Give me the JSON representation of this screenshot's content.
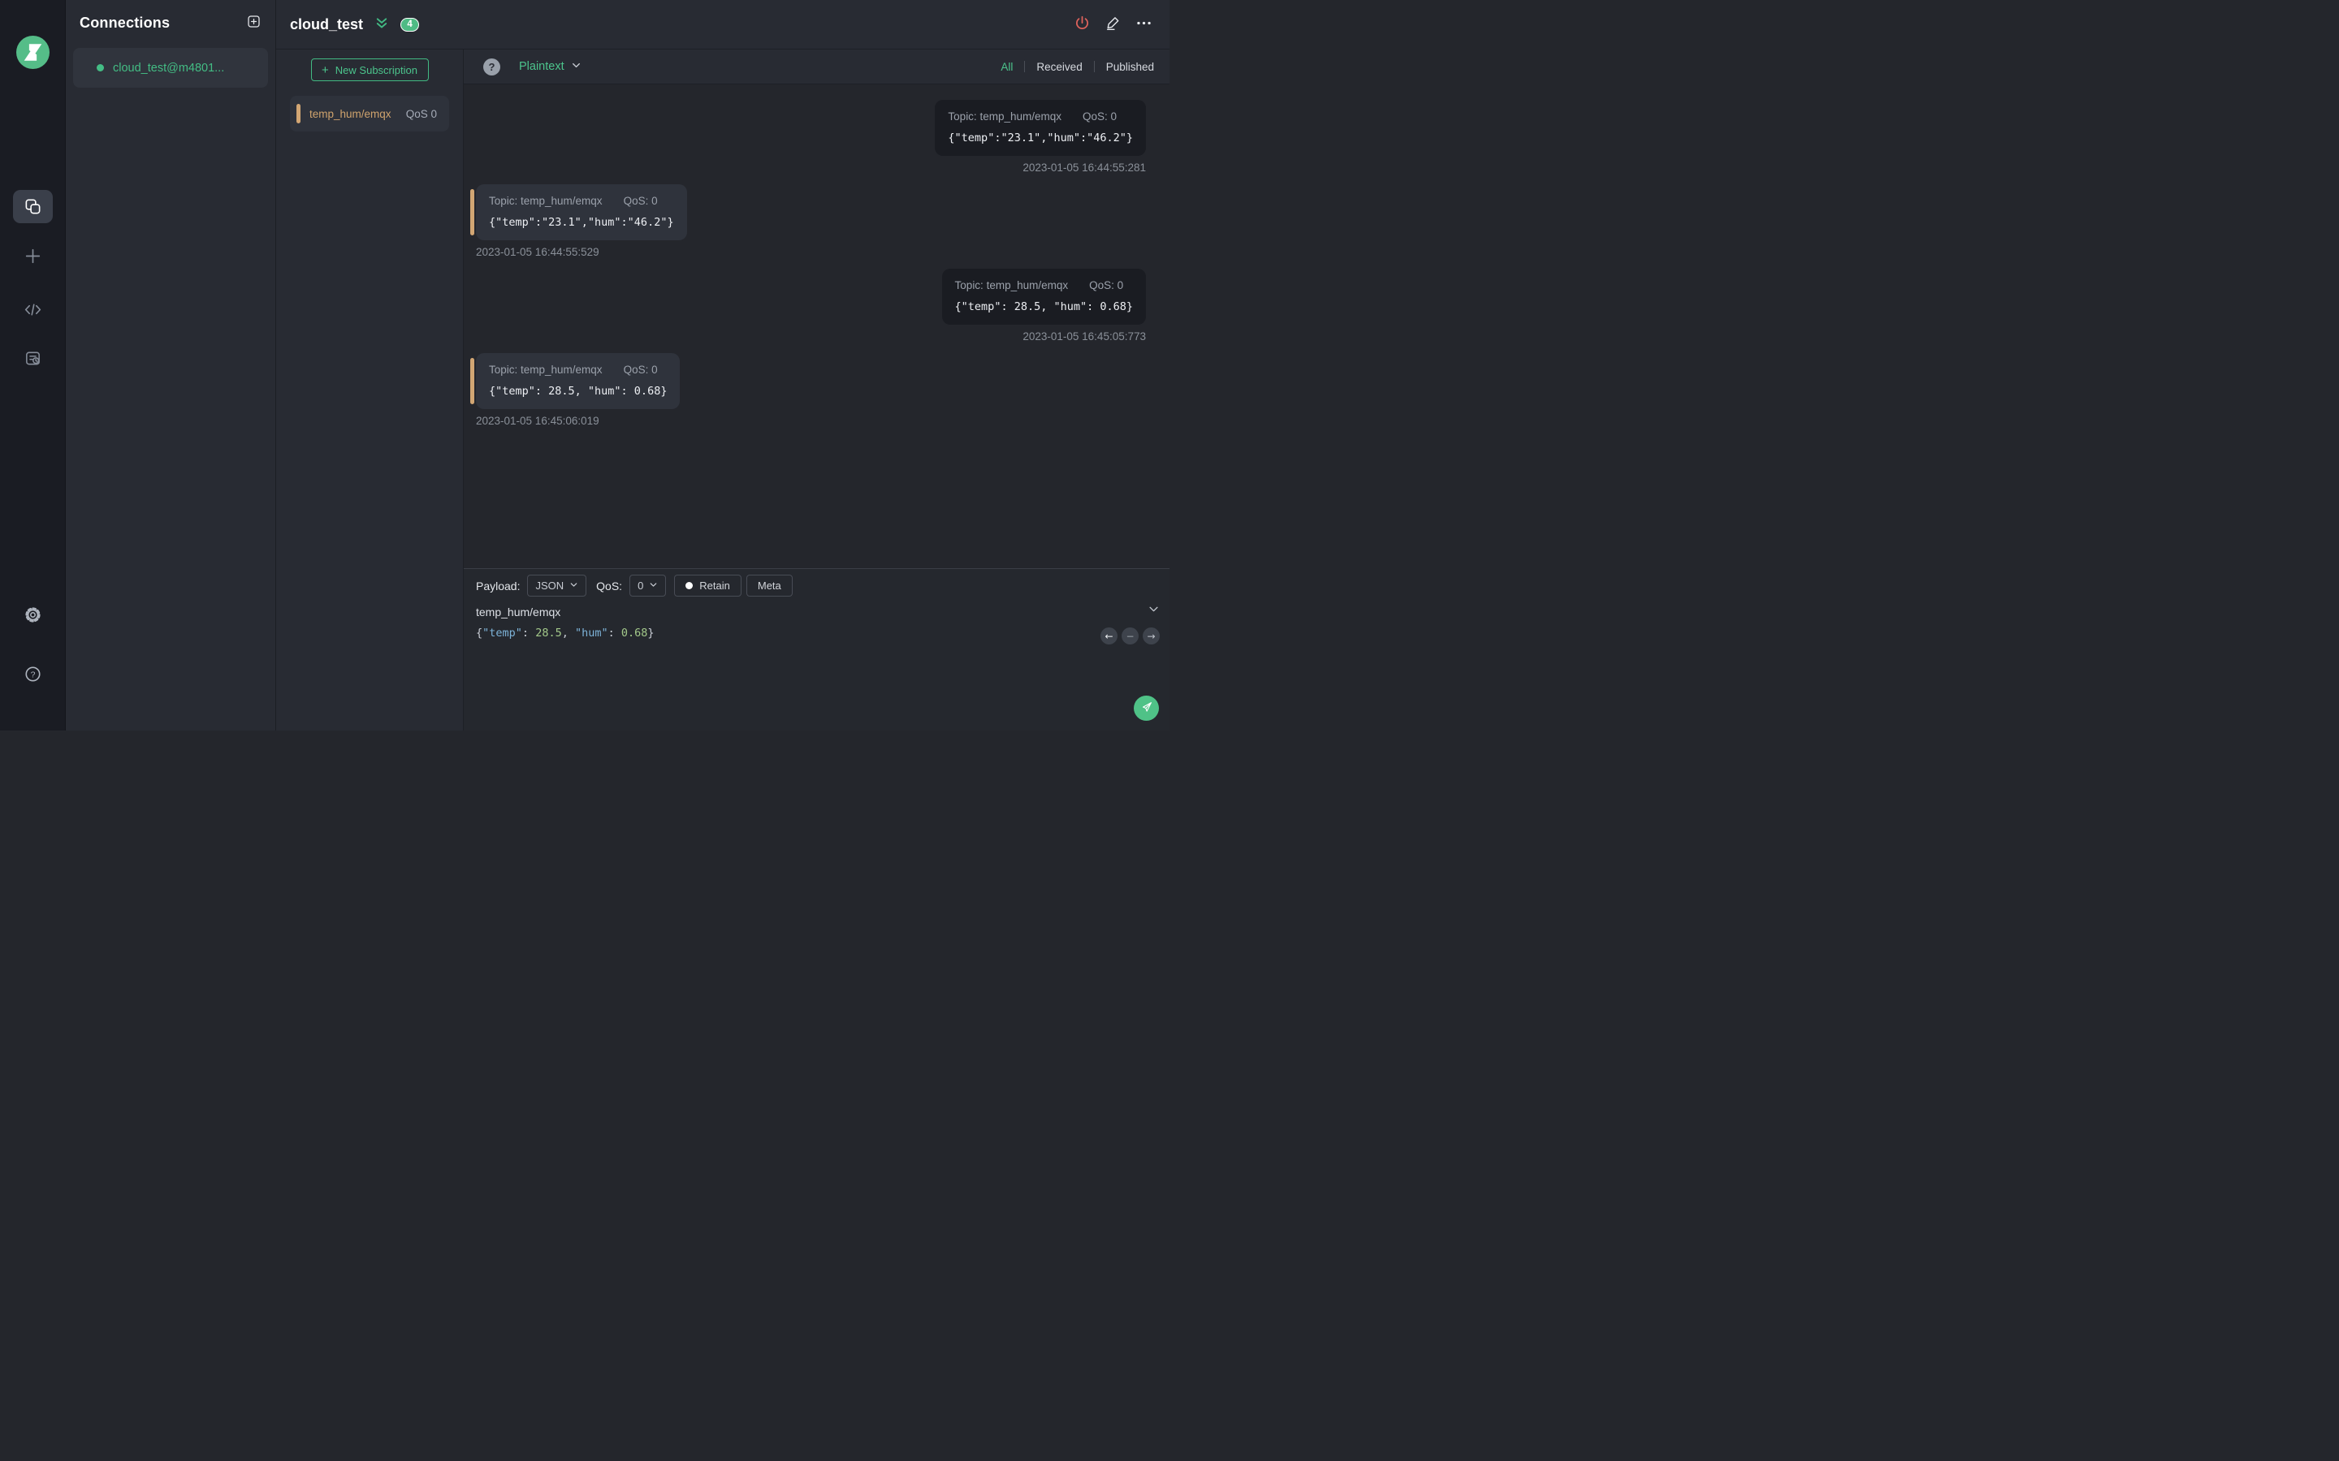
{
  "colors": {
    "accent_green": "#42b983",
    "badge_green": "#4fbb85",
    "subscription_orange": "#d2a673",
    "danger_red": "#e0635c",
    "sidebar_bg": "#1a1c23",
    "panel_bg": "#282b33",
    "messages_bg": "#24262c",
    "published_card_bg": "#1a1c22",
    "received_card_bg": "#2f333c",
    "editor_key_blue": "#7db3d8",
    "editor_number_green": "#a3c98a"
  },
  "glyphs": {
    "question": "?",
    "left_arrow": "←",
    "minus": "−",
    "right_arrow": "→"
  },
  "connections": {
    "title": "Connections",
    "items": [
      {
        "name": "cloud_test@m4801...",
        "connected": true
      }
    ]
  },
  "topbar": {
    "title": "cloud_test",
    "badge_count": "4"
  },
  "subscriptions": {
    "new_button_label": "New Subscription",
    "items": [
      {
        "topic": "temp_hum/emqx",
        "qos": "QoS 0"
      }
    ]
  },
  "messages_header": {
    "format": "Plaintext",
    "filters": {
      "all": "All",
      "received": "Received",
      "published": "Published"
    },
    "active_filter": "All"
  },
  "messages": [
    {
      "direction": "published",
      "topic": "Topic: temp_hum/emqx",
      "qos": "QoS: 0",
      "payload": "{\"temp\":\"23.1\",\"hum\":\"46.2\"}",
      "time": "2023-01-05 16:44:55:281"
    },
    {
      "direction": "received",
      "topic": "Topic: temp_hum/emqx",
      "qos": "QoS: 0",
      "payload": "{\"temp\":\"23.1\",\"hum\":\"46.2\"}",
      "time": "2023-01-05 16:44:55:529"
    },
    {
      "direction": "published",
      "topic": "Topic: temp_hum/emqx",
      "qos": "QoS: 0",
      "payload": "{\"temp\": 28.5, \"hum\": 0.68}",
      "time": "2023-01-05 16:45:05:773"
    },
    {
      "direction": "received",
      "topic": "Topic: temp_hum/emqx",
      "qos": "QoS: 0",
      "payload": "{\"temp\": 28.5, \"hum\": 0.68}",
      "time": "2023-01-05 16:45:06:019"
    }
  ],
  "publish": {
    "payload_label": "Payload:",
    "payload_type": "JSON",
    "qos_label": "QoS:",
    "qos_value": "0",
    "retain_label": "Retain",
    "meta_label": "Meta",
    "topic": "temp_hum/emqx",
    "editor": {
      "tokens": [
        {
          "type": "p",
          "text": "{"
        },
        {
          "type": "k",
          "text": "\"temp\""
        },
        {
          "type": "p",
          "text": ": "
        },
        {
          "type": "n",
          "text": "28.5"
        },
        {
          "type": "p",
          "text": ", "
        },
        {
          "type": "k",
          "text": "\"hum\""
        },
        {
          "type": "p",
          "text": ": "
        },
        {
          "type": "n",
          "text": "0.68"
        },
        {
          "type": "p",
          "text": "}"
        }
      ]
    }
  }
}
